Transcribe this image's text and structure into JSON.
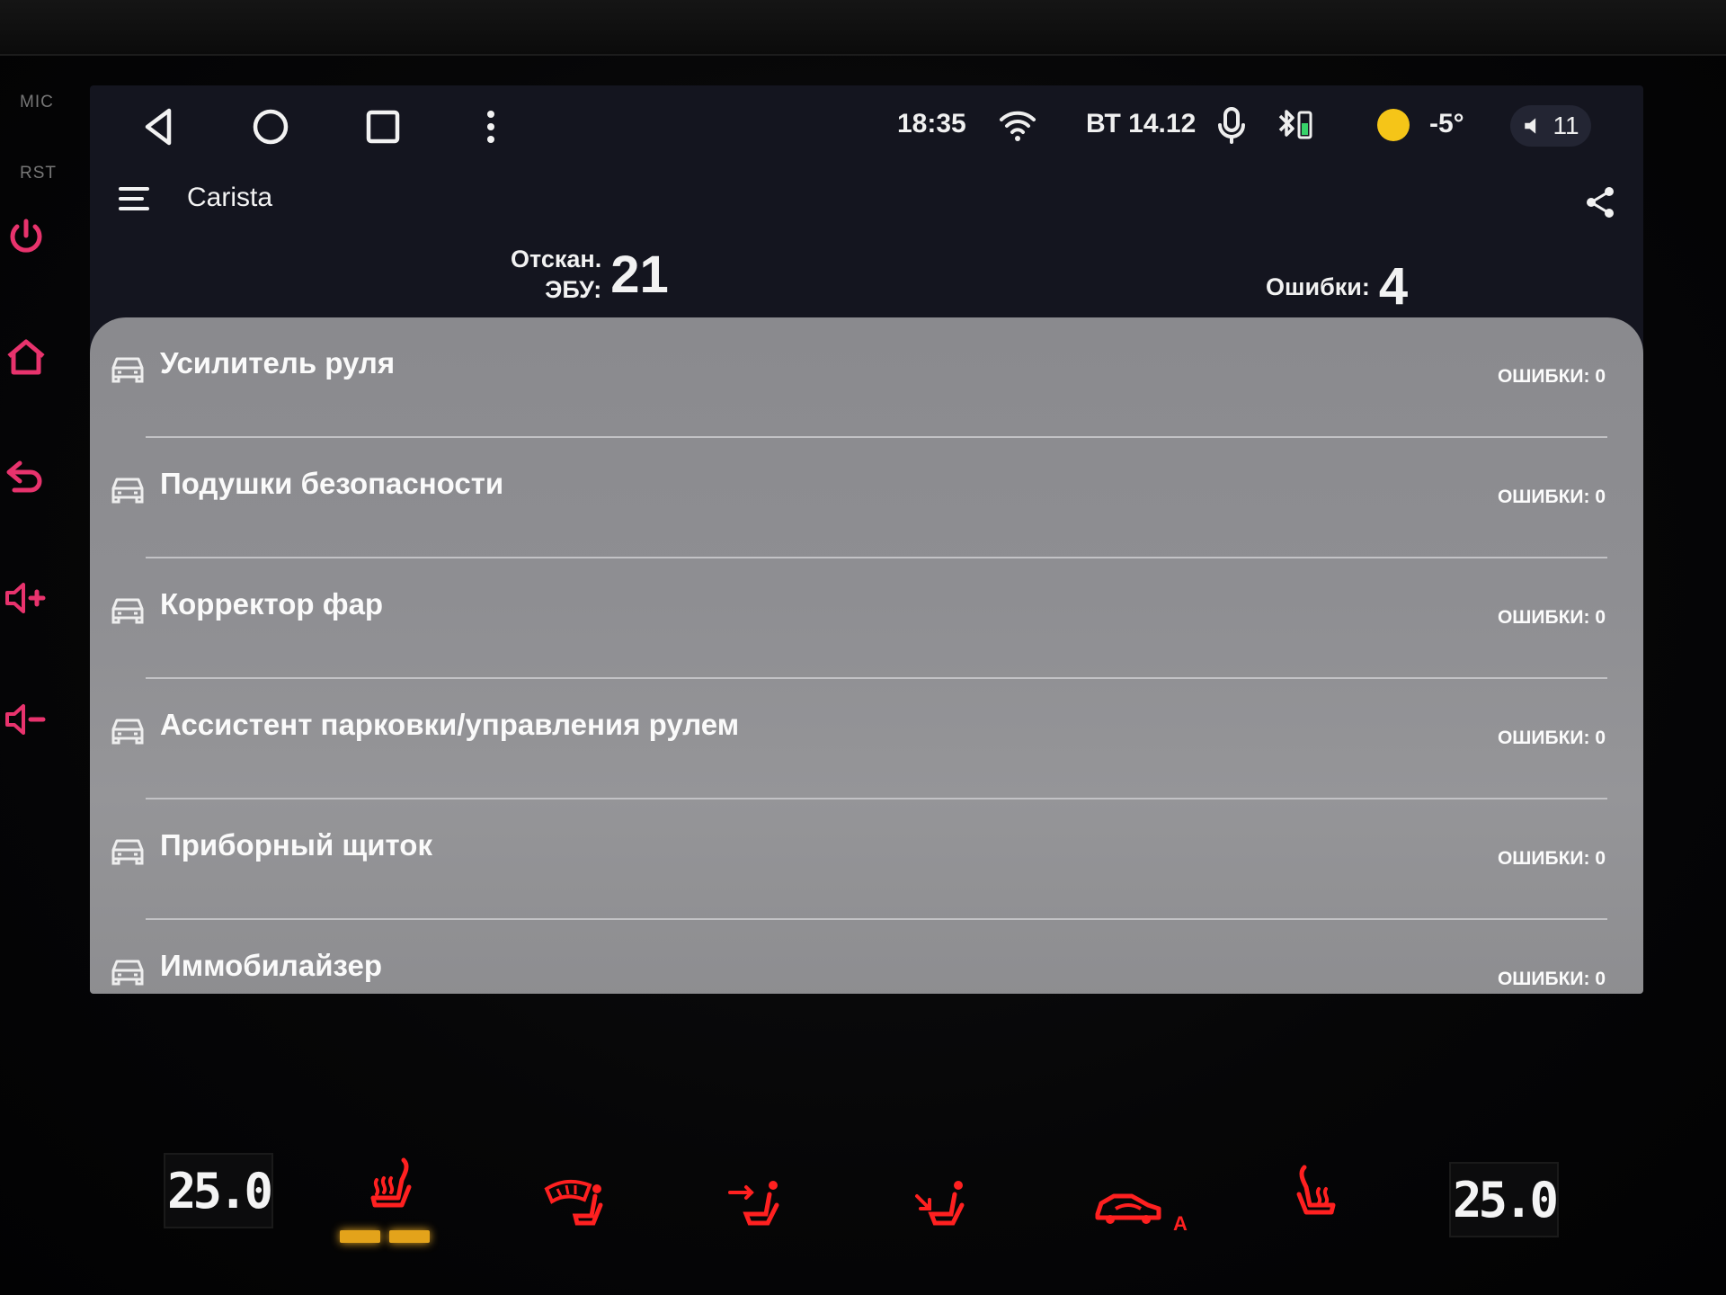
{
  "hardware": {
    "mic_label": "MIC",
    "rst_label": "RST",
    "accent_color": "#e8336d"
  },
  "statusbar": {
    "time": "18:35",
    "date": "ВТ 14.12",
    "temperature": "-5°",
    "volume": "11"
  },
  "app": {
    "title": "Carista"
  },
  "summary": {
    "scanned_label_line1": "Отскан.",
    "scanned_label_line2": "ЭБУ:",
    "scanned_value": "21",
    "errors_label": "Ошибки:",
    "errors_value": "4"
  },
  "modules": [
    {
      "name": "Усилитель руля",
      "errors": "ОШИБКИ: 0"
    },
    {
      "name": "Подушки безопасности",
      "errors": "ОШИБКИ: 0"
    },
    {
      "name": "Корректор фар",
      "errors": "ОШИБКИ: 0"
    },
    {
      "name": "Ассистент парковки/управления рулем",
      "errors": "ОШИБКИ: 0"
    },
    {
      "name": "Приборный щиток",
      "errors": "ОШИБКИ: 0"
    },
    {
      "name": "Иммобилайзер",
      "errors": "ОШИБКИ: 0"
    }
  ],
  "climate": {
    "left_temp": "25.0",
    "right_temp": "25.0",
    "auto_label": "A",
    "icon_color": "#ff2020",
    "led_color": "#e3a31b"
  }
}
